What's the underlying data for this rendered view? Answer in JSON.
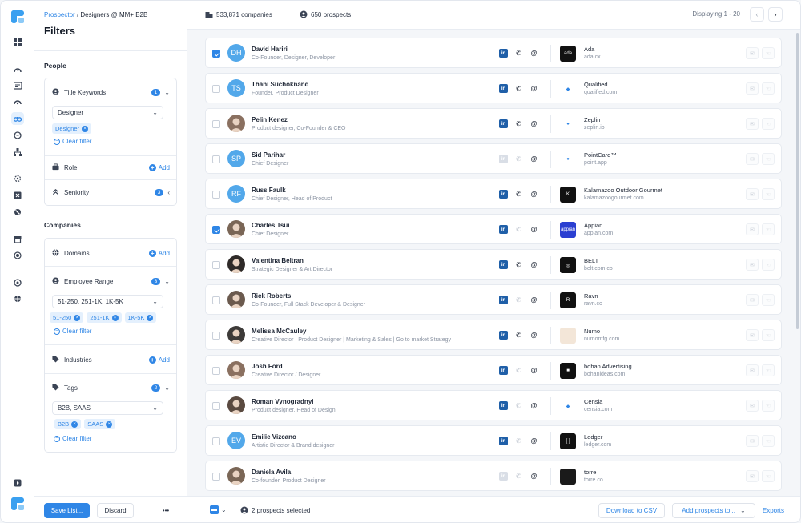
{
  "breadcrumb": {
    "root": "Prospector",
    "separator": "/",
    "current": "Designers @ MM+ B2B"
  },
  "filters": {
    "title": "Filters",
    "people": {
      "heading": "People",
      "title_keywords": {
        "label": "Title Keywords",
        "count": "1",
        "select_value": "Designer",
        "tags": [
          "Designer"
        ],
        "clear": "Clear filter"
      },
      "role": {
        "label": "Role",
        "add": "Add"
      },
      "seniority": {
        "label": "Seniority",
        "count": "3"
      }
    },
    "companies": {
      "heading": "Companies",
      "domains": {
        "label": "Domains",
        "add": "Add"
      },
      "employee_range": {
        "label": "Employee Range",
        "count": "3",
        "select_value": "51-250, 251-1K, 1K-5K",
        "tags": [
          "51-250",
          "251-1K",
          "1K-5K"
        ],
        "clear": "Clear filter"
      },
      "industries": {
        "label": "Industries",
        "add": "Add"
      },
      "tags": {
        "label": "Tags",
        "count": "2",
        "select_value": "B2B, SAAS",
        "tags": [
          "B2B",
          "SAAS"
        ],
        "clear": "Clear filter"
      }
    },
    "footer": {
      "save": "Save List...",
      "discard": "Discard",
      "more": "•••"
    }
  },
  "topbar": {
    "companies": "533,871 companies",
    "prospects": "650 prospects",
    "displaying": "Displaying 1 - 20",
    "prev": "‹",
    "next": "›"
  },
  "prospects": [
    {
      "name": "David Hariri",
      "title": "Co-Founder, Designer, Developer",
      "initials": "DH",
      "checked": true,
      "avatar": "initials",
      "li": true,
      "phone": true,
      "company": "Ada",
      "domain": "ada.cx",
      "logo_bg": "#111111",
      "logo_text": "ada"
    },
    {
      "name": "Thani Suchoknand",
      "title": "Founder, Product Designer",
      "initials": "TS",
      "checked": false,
      "avatar": "initials",
      "li": true,
      "phone": true,
      "company": "Qualified",
      "domain": "qualified.com",
      "logo_bg": "#ffffff",
      "logo_text": "◆"
    },
    {
      "name": "Pelin Kenez",
      "title": "Product designer, Co-Founder & CEO",
      "initials": "PK",
      "checked": false,
      "avatar": "photo",
      "li": true,
      "phone": true,
      "company": "Zeplin",
      "domain": "zeplin.io",
      "logo_bg": "#ffffff",
      "logo_text": "●"
    },
    {
      "name": "Sid Parihar",
      "title": "Chief Designer",
      "initials": "SP",
      "checked": false,
      "avatar": "initials",
      "li": false,
      "phone": false,
      "company": "PointCard™",
      "domain": "point.app",
      "logo_bg": "#ffffff",
      "logo_text": "●"
    },
    {
      "name": "Russ Faulk",
      "title": "Chief Designer, Head of Product",
      "initials": "RF",
      "checked": false,
      "avatar": "initials",
      "li": true,
      "phone": true,
      "company": "Kalamazoo Outdoor Gourmet",
      "domain": "kalamazoogourmet.com",
      "logo_bg": "#111111",
      "logo_text": "K"
    },
    {
      "name": "Charles Tsui",
      "title": "Chief Designer",
      "initials": "CT",
      "checked": true,
      "avatar": "photo",
      "li": true,
      "phone": false,
      "company": "Appian",
      "domain": "appian.com",
      "logo_bg": "#2b3fd1",
      "logo_text": "appian"
    },
    {
      "name": "Valentina Beltran",
      "title": "Strategic Designer & Art Director",
      "initials": "VB",
      "checked": false,
      "avatar": "photo",
      "li": true,
      "phone": true,
      "company": "BELT",
      "domain": "belt.com.co",
      "logo_bg": "#111111",
      "logo_text": "◎"
    },
    {
      "name": "Rick Roberts",
      "title": "Co-Founder, Full Stack Developer & Designer",
      "initials": "RR",
      "checked": false,
      "avatar": "photo",
      "li": true,
      "phone": false,
      "company": "Ravn",
      "domain": "ravn.co",
      "logo_bg": "#111111",
      "logo_text": "R"
    },
    {
      "name": "Melissa McCauley",
      "title": "Creative Director | Product Designer | Marketing & Sales | Go to market Strategy",
      "initials": "MM",
      "checked": false,
      "avatar": "photo",
      "li": true,
      "phone": true,
      "company": "Numo",
      "domain": "numomfg.com",
      "logo_bg": "#f3e6d8",
      "logo_text": ""
    },
    {
      "name": "Josh Ford",
      "title": "Creative Director / Designer",
      "initials": "JF",
      "checked": false,
      "avatar": "photo",
      "li": true,
      "phone": false,
      "company": "bohan Advertising",
      "domain": "bohanideas.com",
      "logo_bg": "#111111",
      "logo_text": "■"
    },
    {
      "name": "Roman Vynogradnyi",
      "title": "Product designer, Head of Design",
      "initials": "RV",
      "checked": false,
      "avatar": "photo",
      "li": true,
      "phone": false,
      "company": "Censia",
      "domain": "censia.com",
      "logo_bg": "#ffffff",
      "logo_text": "◆"
    },
    {
      "name": "Emilie Vizcano",
      "title": "Artistic Director & Brand designer",
      "initials": "EV",
      "checked": false,
      "avatar": "initials",
      "li": true,
      "phone": false,
      "company": "Ledger",
      "domain": "ledger.com",
      "logo_bg": "#111111",
      "logo_text": "[ ]"
    },
    {
      "name": "Daniela Avila",
      "title": "Co-founder, Product Designer",
      "initials": "DA",
      "checked": false,
      "avatar": "photo",
      "li": false,
      "phone": false,
      "company": "torre",
      "domain": "torre.co",
      "logo_bg": "#1a1a1a",
      "logo_text": ""
    }
  ],
  "bottombar": {
    "selected": "2 prospects selected",
    "download": "Download to CSV",
    "add_to": "Add prospects to...",
    "exports": "Exports"
  },
  "colors": {
    "accent": "#2f86e6",
    "avatar_initials": "#52a8ea"
  },
  "icons": [
    "grid-icon",
    "gauge-icon",
    "list-icon",
    "binoculars-icon",
    "globe-icon",
    "building-icon",
    "linkedin-icon",
    "phone-icon",
    "at-icon",
    "mail-icon",
    "hand-icon"
  ]
}
